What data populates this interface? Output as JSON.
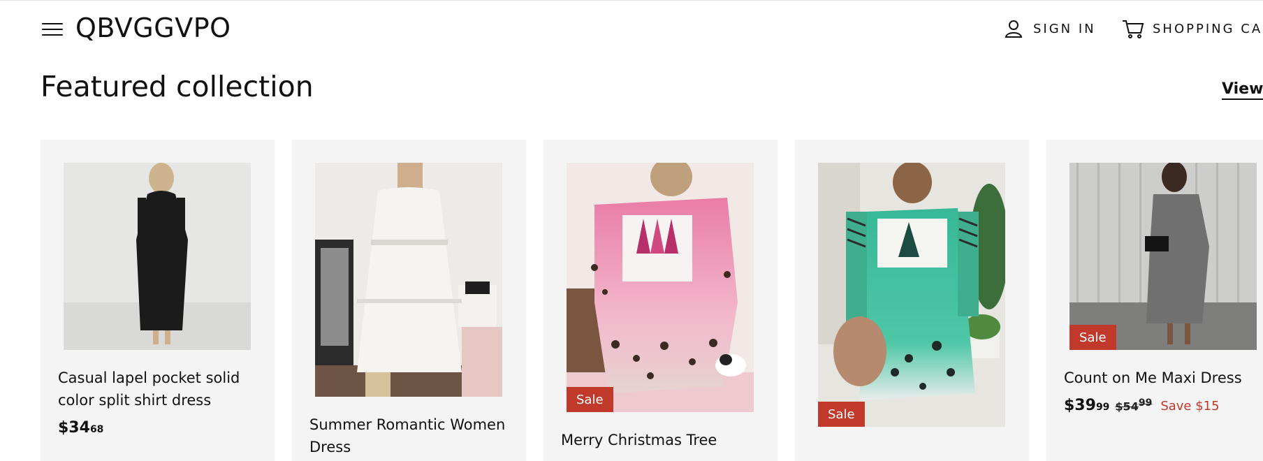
{
  "header": {
    "brand": "QBVGGVPO",
    "sign_in": "SIGN IN",
    "cart": "SHOPPING CART"
  },
  "section": {
    "title": "Featured collection",
    "view_all": "View all"
  },
  "colors": {
    "sale_badge": "#c0392b",
    "card_bg": "#f4f4f4",
    "text": "#111111"
  },
  "products": [
    {
      "title": "Casual lapel pocket solid color split shirt dress",
      "price_dollars": "$34",
      "price_cents": "68",
      "image": "black-shirt-dress-photo"
    },
    {
      "title": "Summer Romantic Women Dress",
      "image": "white-lace-dress-photo"
    },
    {
      "title": "Merry Christmas Tree",
      "badge": "Sale",
      "image": "pink-christmas-dress-photo"
    },
    {
      "badge": "Sale",
      "image": "green-christmas-dress-photo"
    },
    {
      "title": "Count on Me Maxi Dress",
      "badge": "Sale",
      "price_dollars": "$39",
      "price_cents": "99",
      "was_dollars": "$54",
      "was_cents": "99",
      "save": "Save $15",
      "image": "gray-maxi-dress-photo"
    }
  ]
}
